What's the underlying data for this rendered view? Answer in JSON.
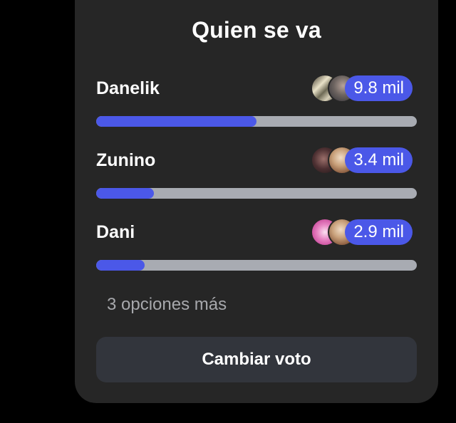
{
  "poll": {
    "title": "Quien se va",
    "options": [
      {
        "label": "Danelik",
        "votes": "9.8 mil",
        "fraction": 0.5,
        "avatars": [
          "abstract-photo-avatar",
          "person-photo-avatar"
        ]
      },
      {
        "label": "Zunino",
        "votes": "3.4 mil",
        "fraction": 0.18,
        "avatars": [
          "dark-photo-avatar",
          "person-photo-avatar"
        ]
      },
      {
        "label": "Dani",
        "votes": "2.9 mil",
        "fraction": 0.15,
        "avatars": [
          "pink-photo-avatar",
          "person-photo-avatar"
        ]
      }
    ],
    "more_options": "3 opciones más",
    "change_vote": "Cambiar voto"
  },
  "colors": {
    "accent": "#4b58e8",
    "card_bg": "#262626",
    "track": "#a8abb2",
    "button_bg": "#32353c"
  }
}
